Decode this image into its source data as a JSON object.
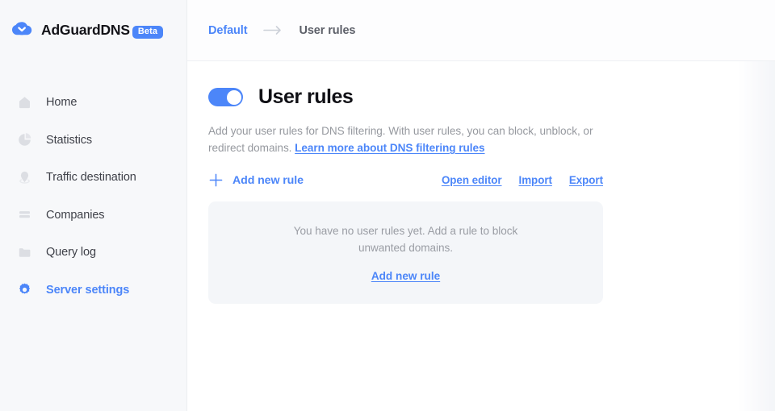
{
  "brand": {
    "name_thin": "AdGuard",
    "name_bold": "DNS",
    "badge": "Beta",
    "logo_icon": "shield-check-down-icon",
    "accent_color": "#4c86f9"
  },
  "sidebar": {
    "background_color": "#f7f8fa",
    "items": [
      {
        "label": "Home",
        "icon": "home-icon",
        "active": false
      },
      {
        "label": "Statistics",
        "icon": "pie-chart-icon",
        "active": false
      },
      {
        "label": "Traffic destination",
        "icon": "location-pin-icon",
        "active": false
      },
      {
        "label": "Companies",
        "icon": "layers-icon",
        "active": false
      },
      {
        "label": "Query log",
        "icon": "folder-icon",
        "active": false
      },
      {
        "label": "Server settings",
        "icon": "gear-icon",
        "active": true
      }
    ]
  },
  "topbar": {
    "breadcrumb": {
      "parent": "Default",
      "separator_icon": "arrow-right-icon",
      "current": "User rules"
    }
  },
  "main": {
    "toggle": {
      "state": "on",
      "color": "#4c86f9"
    },
    "title": "User rules",
    "description_before": "Add your user rules for DNS filtering. With user rules, you can block, unblock, or redirect domains. ",
    "description_link": "Learn more about DNS filtering rules",
    "add_rule": {
      "label": "Add new rule",
      "icon": "plus-icon"
    },
    "actions": [
      {
        "label": "Open editor"
      },
      {
        "label": "Import"
      },
      {
        "label": "Export"
      }
    ],
    "empty_state": {
      "message": "You have no user rules yet. Add a rule to block unwanted domains.",
      "link": "Add new rule",
      "background_color": "#f4f6f9"
    }
  }
}
